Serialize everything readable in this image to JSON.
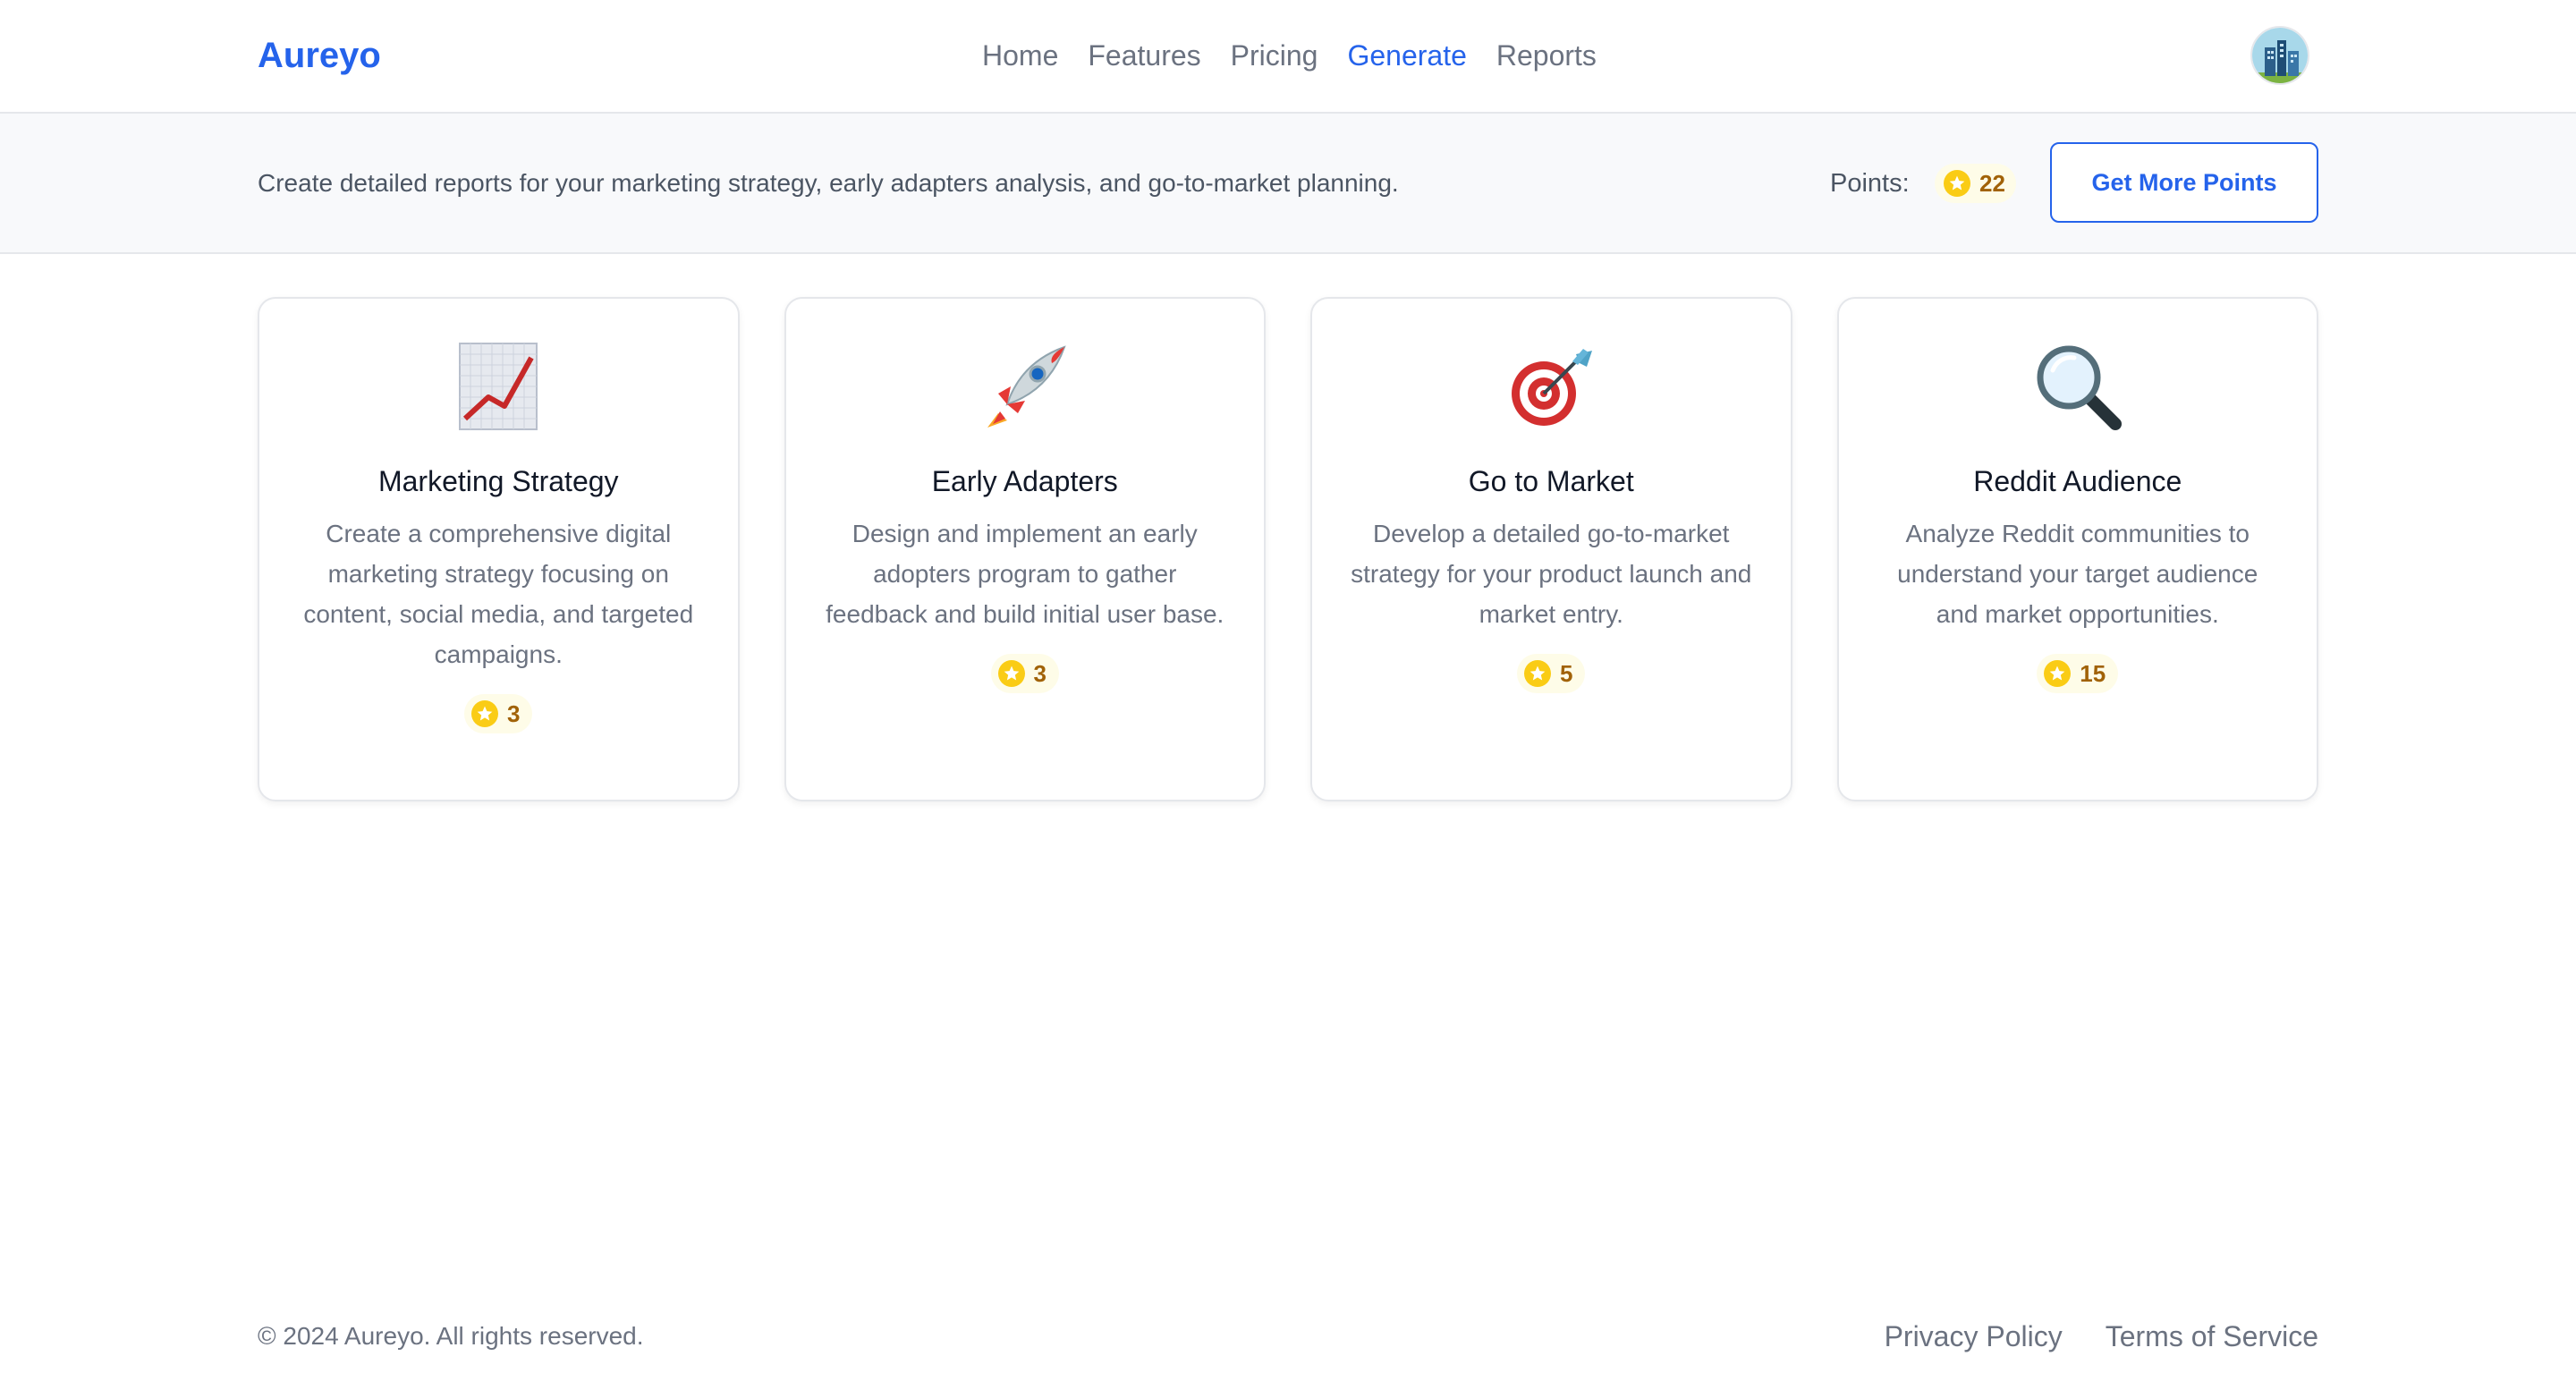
{
  "header": {
    "logo": "Aureyo",
    "nav": [
      {
        "label": "Home"
      },
      {
        "label": "Features"
      },
      {
        "label": "Pricing"
      },
      {
        "label": "Generate",
        "active": true
      },
      {
        "label": "Reports"
      }
    ]
  },
  "subbar": {
    "description": "Create detailed reports for your marketing strategy, early adapters analysis, and go-to-market planning.",
    "points_label": "Points:",
    "points_value": "22",
    "get_points_label": "Get More Points"
  },
  "cards": [
    {
      "icon": "chart-increasing-icon",
      "title": "Marketing Strategy",
      "description": "Create a comprehensive digital marketing strategy focusing on content, social media, and targeted campaigns.",
      "cost": "3"
    },
    {
      "icon": "rocket-icon",
      "title": "Early Adapters",
      "description": "Design and implement an early adopters program to gather feedback and build initial user base.",
      "cost": "3"
    },
    {
      "icon": "target-icon",
      "title": "Go to Market",
      "description": "Develop a detailed go-to-market strategy for your product launch and market entry.",
      "cost": "5"
    },
    {
      "icon": "magnifying-glass-icon",
      "title": "Reddit Audience",
      "description": "Analyze Reddit communities to understand your target audience and market opportunities.",
      "cost": "15"
    }
  ],
  "footer": {
    "copyright": "© 2024 Aureyo. All rights reserved.",
    "links": [
      {
        "label": "Privacy Policy"
      },
      {
        "label": "Terms of Service"
      }
    ]
  },
  "colors": {
    "accent": "#2563eb",
    "star": "#facc15",
    "points_text": "#a16207"
  }
}
